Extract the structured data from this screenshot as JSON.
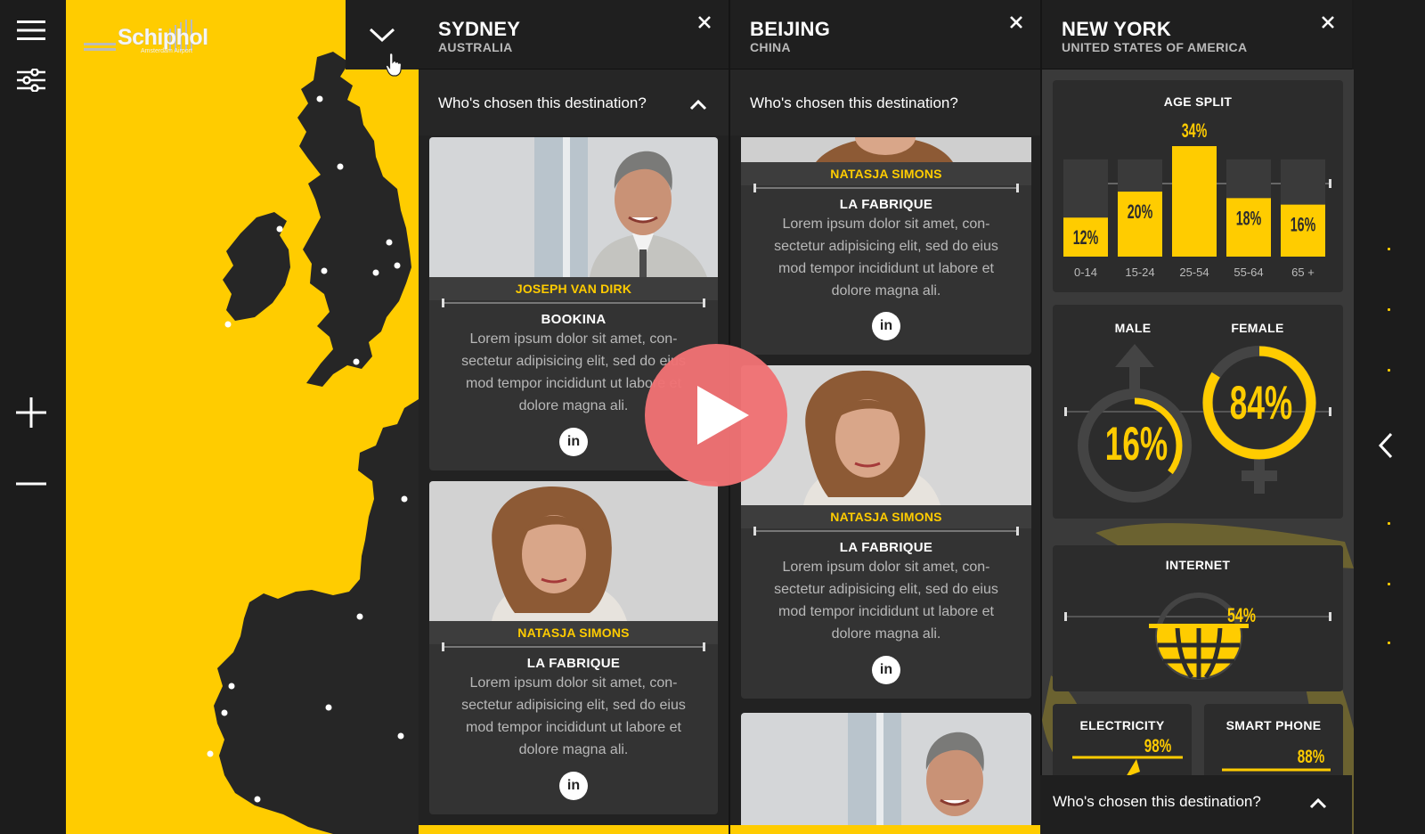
{
  "logo": {
    "text": "Schiphol",
    "sub": "Amsterdam Airport"
  },
  "colors": {
    "accent": "#ffcc00",
    "panel": "#333333",
    "play": "#ef7274"
  },
  "toolbar": {
    "icons": [
      "menu-icon",
      "filter-icon",
      "zoom-in-icon",
      "zoom-out-icon"
    ]
  },
  "columns": [
    {
      "city": "SYDNEY",
      "country": "AUSTRALIA",
      "who": "Who's chosen this destination?",
      "cards": [
        {
          "name": "JOSEPH VAN DIRK",
          "company": "BOOKINA",
          "desc": "Lorem ipsum dolor sit amet, con-sectetur adipisicing elit, sed do eius mod tempor incididunt ut labore et dolore magna ali."
        },
        {
          "name": "NATASJA SIMONS",
          "company": "LA FABRIQUE",
          "desc": "Lorem ipsum dolor sit amet, con-sectetur adipisicing elit, sed do eius mod tempor incididunt ut labore et dolore magna ali."
        }
      ]
    },
    {
      "city": "BEIJING",
      "country": "CHINA",
      "who": "Who's chosen this destination?",
      "cards": [
        {
          "name": "NATASJA SIMONS",
          "company": "LA FABRIQUE",
          "desc": "Lorem ipsum dolor sit amet, con-sectetur adipisicing elit, sed do eius mod tempor incididunt ut labore et dolore magna ali."
        },
        {
          "name": "NATASJA SIMONS",
          "company": "LA FABRIQUE",
          "desc": "Lorem ipsum dolor sit amet, con-sectetur adipisicing elit, sed do eius mod tempor incididunt ut labore et dolore magna ali."
        }
      ]
    },
    {
      "city": "NEW YORK",
      "country": "UNITED STATES OF AMERICA",
      "who": "Who's chosen this destination?"
    }
  ],
  "linkedin": "in",
  "stats": {
    "age_title": "AGE SPLIT",
    "gender": {
      "male_label": "MALE",
      "female_label": "FEMALE",
      "male_value": "16%",
      "female_value": "84%",
      "male_pct": 16,
      "female_pct": 84
    },
    "internet": {
      "label": "INTERNET",
      "value": "54%"
    },
    "electricity": {
      "label": "ELECTRICITY",
      "value": "98%"
    },
    "smartphone": {
      "label": "SMART PHONE",
      "value": "88%"
    }
  },
  "chart_data": {
    "type": "bar",
    "title": "AGE SPLIT",
    "categories": [
      "0-14",
      "15-24",
      "25-54",
      "55-64",
      "65 +"
    ],
    "values": [
      12,
      20,
      34,
      18,
      16
    ],
    "value_labels": [
      "12%",
      "20%",
      "34%",
      "18%",
      "16%"
    ],
    "ylim": [
      0,
      34
    ]
  }
}
